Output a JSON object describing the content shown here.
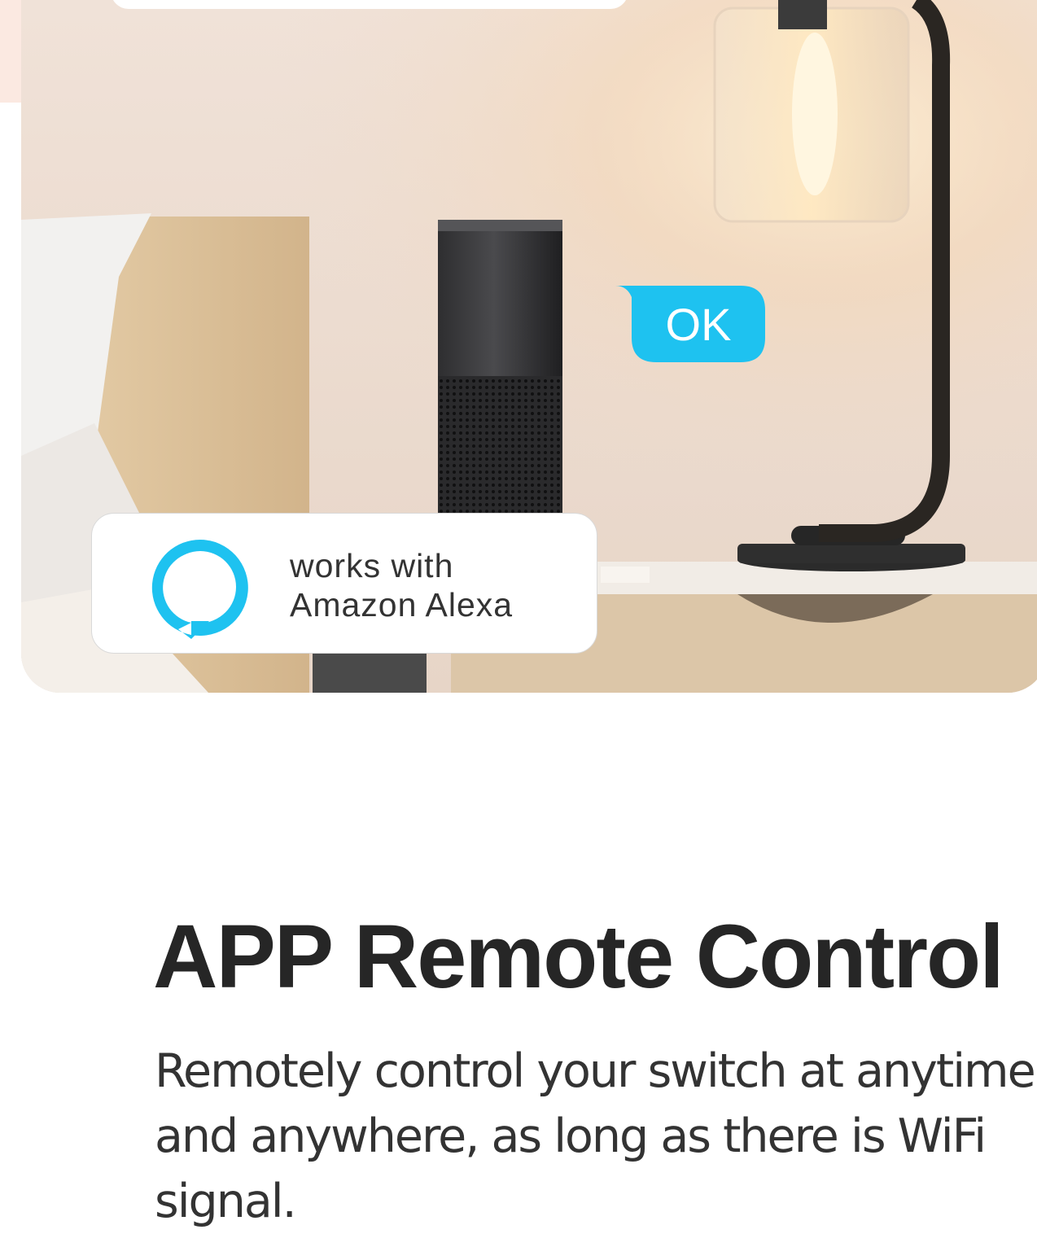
{
  "hero": {
    "ok_bubble_text": "OK",
    "alexa_badge": {
      "line1": "works with",
      "line2": "Amazon Alexa",
      "icon": "alexa-ring-icon",
      "color": "#1ec2f0"
    }
  },
  "section": {
    "title": "APP Remote Control",
    "description": "Remotely control your switch at anytime and anywhere, as long as there is WiFi signal."
  },
  "colors": {
    "accent": "#1ec2f0",
    "title": "#262626",
    "body_text": "#333333",
    "peach": "#fbe9e1"
  }
}
